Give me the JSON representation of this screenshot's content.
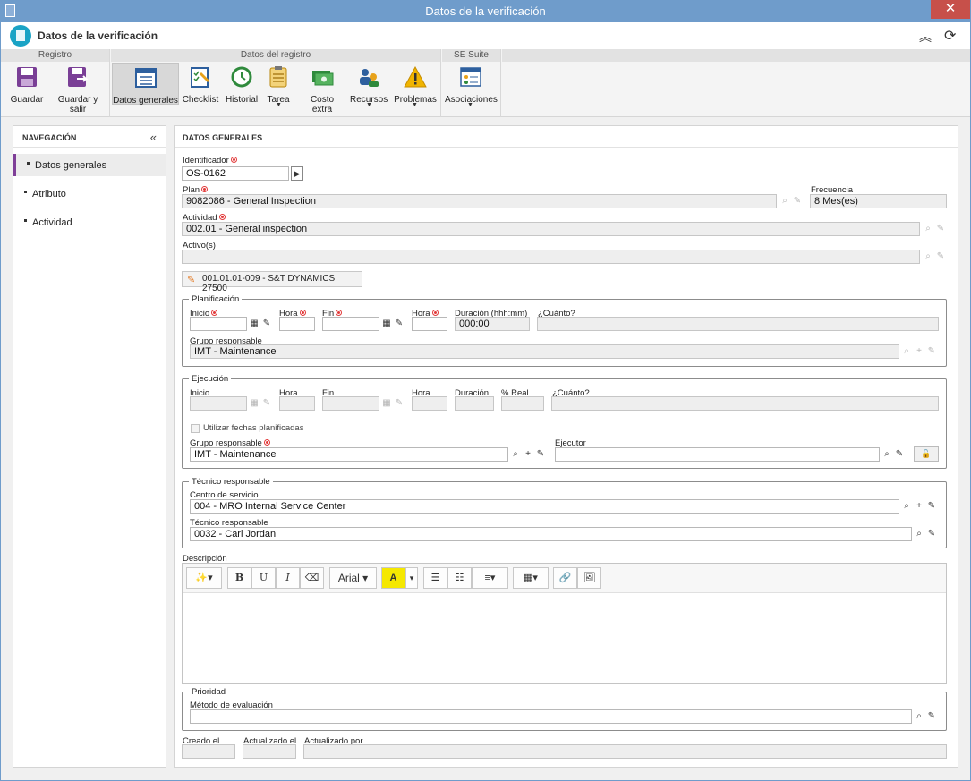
{
  "window": {
    "title": "Datos de la verificación",
    "close_symbol": "✕"
  },
  "app": {
    "title": "Datos de la verificación",
    "collapse_symbol": "︽",
    "refresh_symbol": "⟳"
  },
  "ribbon": {
    "groups": [
      {
        "label": "Registro"
      },
      {
        "label": "Datos del registro"
      },
      {
        "label": "SE Suite"
      }
    ],
    "buttons": [
      {
        "label": "Guardar",
        "icon": "save-icon"
      },
      {
        "label": "Guardar y salir",
        "icon": "save-exit-icon"
      },
      {
        "label": "Datos generales",
        "icon": "form-icon",
        "active": true
      },
      {
        "label": "Checklist",
        "icon": "checklist-icon"
      },
      {
        "label": "Historial",
        "icon": "history-icon"
      },
      {
        "label": "Tarea",
        "icon": "clipboard-icon",
        "dropdown": true
      },
      {
        "label": "Costo extra",
        "icon": "money-icon"
      },
      {
        "label": "Recursos",
        "icon": "resources-icon",
        "dropdown": true
      },
      {
        "label": "Problemas",
        "icon": "warning-icon",
        "dropdown": true
      },
      {
        "label": "Asociaciones",
        "icon": "associations-icon",
        "dropdown": true
      }
    ],
    "colors": {
      "blue": "#2d5f9e",
      "purple": "#7a3f96",
      "green": "#2f8a3c",
      "orange": "#e8a21a",
      "yellow": "#f0b400"
    }
  },
  "nav": {
    "title": "NAVEGACIÓN",
    "collapse_symbol": "«",
    "items": [
      {
        "label": "Datos generales",
        "active": true
      },
      {
        "label": "Atributo"
      },
      {
        "label": "Actividad"
      }
    ],
    "accent": "#7f3f98"
  },
  "main": {
    "title": "DATOS GENERALES",
    "identificador": {
      "label": "Identificador",
      "value": "OS-0162"
    },
    "plan": {
      "label": "Plan",
      "value": "9082086 - General Inspection"
    },
    "frecuencia": {
      "label": "Frecuencia",
      "value": "8 Mes(es)"
    },
    "actividad": {
      "label": "Actividad",
      "value": "002.01 - General inspection"
    },
    "activos": {
      "label": "Activo(s)",
      "value": ""
    },
    "asset_tag": "001.01.01-009 - S&T DYNAMICS 27500",
    "planificacion": {
      "legend": "Planificación",
      "inicio": "Inicio",
      "hora": "Hora",
      "fin": "Fin",
      "hora2": "Hora",
      "duracion": "Duración (hhh:mm)",
      "duracion_value": "000:00",
      "cuanto": "¿Cuánto?",
      "grupo_label": "Grupo responsable",
      "grupo_value": "IMT - Maintenance"
    },
    "ejecucion": {
      "legend": "Ejecución",
      "inicio": "Inicio",
      "hora": "Hora",
      "fin": "Fin",
      "hora2": "Hora",
      "duracion": "Duración",
      "real": "% Real",
      "cuanto": "¿Cuánto?",
      "usar_fechas": "Utilizar fechas planificadas",
      "grupo_label": "Grupo responsable",
      "grupo_value": "IMT - Maintenance",
      "ejecutor_label": "Ejecutor",
      "ejecutor_value": ""
    },
    "tecnico": {
      "legend": "Técnico responsable",
      "centro_label": "Centro de servicio",
      "centro_value": "004 - MRO Internal Service Center",
      "tecnico_label": "Técnico responsable",
      "tecnico_value": "0032 - Carl Jordan"
    },
    "descripcion": {
      "label": "Descripción",
      "toolbar": {
        "magic": "✨▾",
        "bold": "B",
        "underline": "U",
        "italic": "I",
        "eraser": "⌫",
        "font": "Arial ▾",
        "color": "A",
        "color_caret": "▾",
        "ul": "☰",
        "ol": "☷",
        "align": "≡▾",
        "table": "▦▾",
        "link": "🔗",
        "image": "🖼"
      }
    },
    "prioridad": {
      "legend": "Prioridad",
      "metodo_label": "Método de evaluación",
      "metodo_value": ""
    },
    "footer": {
      "creado": "Creado el",
      "actualizado": "Actualizado el",
      "actualizado_por": "Actualizado por"
    }
  }
}
